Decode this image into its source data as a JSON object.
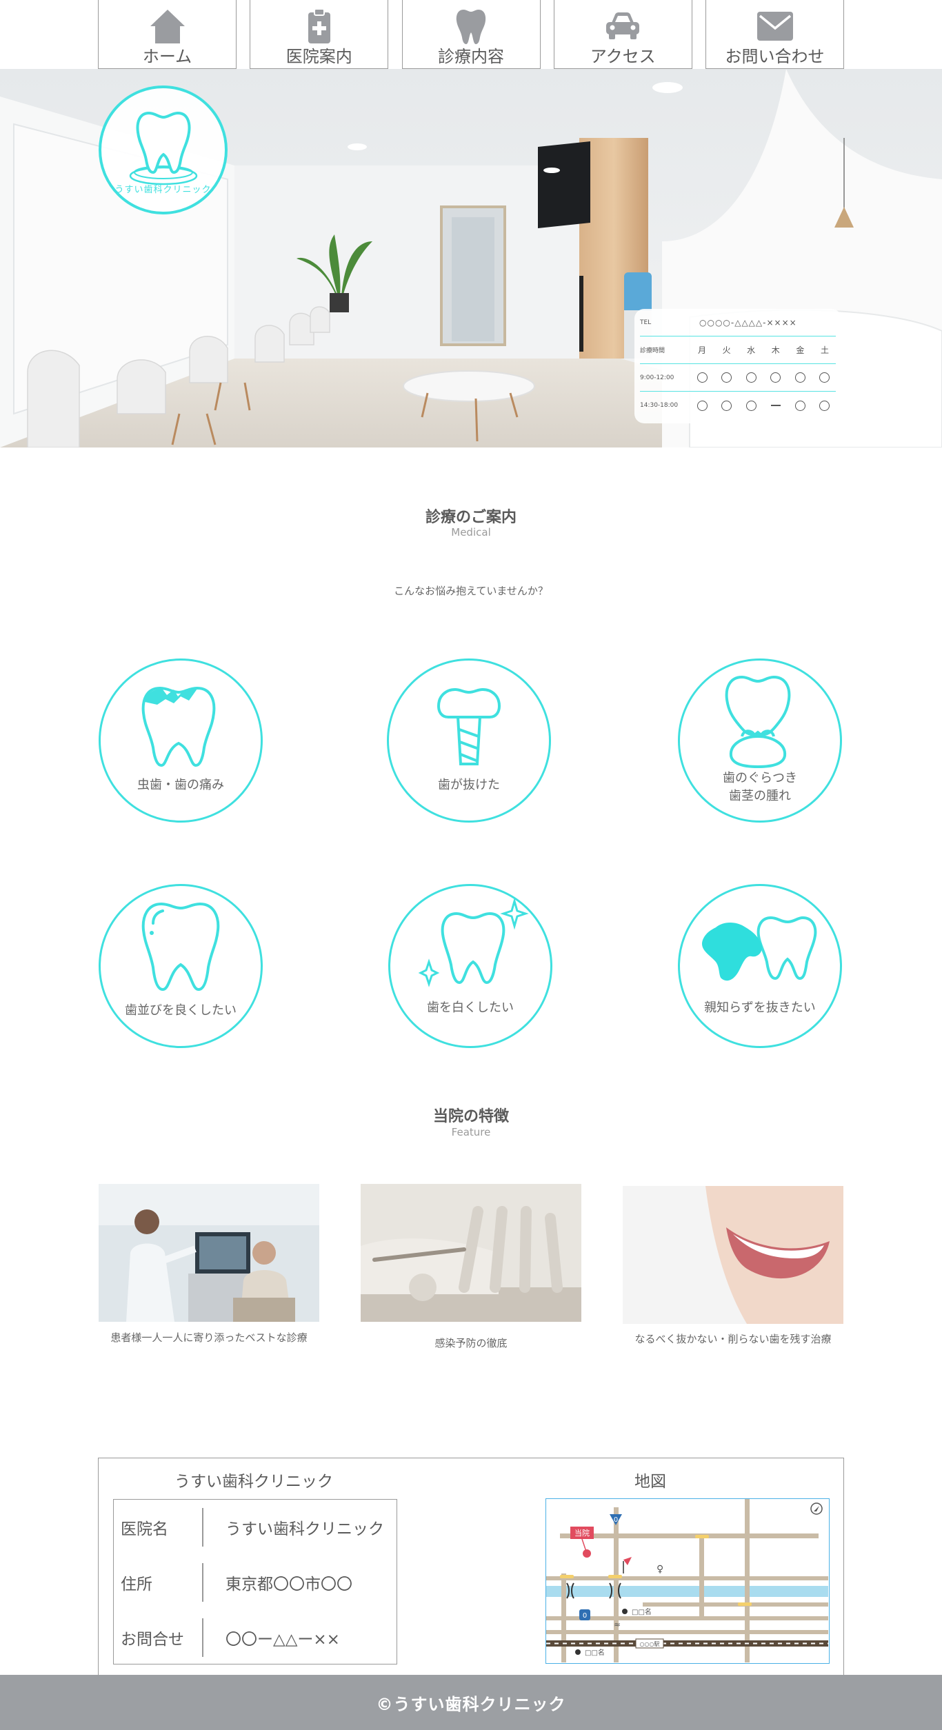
{
  "nav": [
    {
      "label": "ホーム",
      "icon": "home-icon"
    },
    {
      "label": "医院案内",
      "icon": "clipboard-medical-icon"
    },
    {
      "label": "診療内容",
      "icon": "tooth-icon"
    },
    {
      "label": "アクセス",
      "icon": "car-icon"
    },
    {
      "label": "お問い合わせ",
      "icon": "mail-icon"
    }
  ],
  "hero": {
    "logo_text": "うすい歯科クリニック",
    "hours": {
      "tel_label": "TEL",
      "tel_value": "○○○○-△△△△-××××",
      "header_label": "診療時間",
      "days": [
        "月",
        "火",
        "水",
        "木",
        "金",
        "土"
      ],
      "rows": [
        {
          "time": "9:00-12:00",
          "marks": [
            "○",
            "○",
            "○",
            "○",
            "○",
            "○"
          ]
        },
        {
          "time": "14:30-18:00",
          "marks": [
            "○",
            "○",
            "○",
            "ー",
            "○",
            "○"
          ]
        }
      ]
    }
  },
  "medical": {
    "title": "診療のご案内",
    "subtitle": "Medical",
    "lead": "こんなお悩み抱えていませんか？",
    "items": [
      {
        "label": "虫歯・歯の痛み",
        "icon": "cavity-tooth-icon"
      },
      {
        "label": "歯が抜けた",
        "icon": "implant-icon"
      },
      {
        "label_line1": "歯のぐらつき",
        "label_line2": "歯茎の腫れ",
        "icon": "gum-tooth-icon"
      },
      {
        "label": "歯並びを良くしたい",
        "icon": "straight-tooth-icon"
      },
      {
        "label": "歯を白くしたい",
        "icon": "sparkle-tooth-icon"
      },
      {
        "label": "親知らずを抜きたい",
        "icon": "wisdom-tooth-icon"
      }
    ]
  },
  "feature": {
    "title": "当院の特徴",
    "subtitle": "Feature",
    "items": [
      {
        "caption": "患者様一人一人に寄り添ったベストな診療"
      },
      {
        "caption": "感染予防の徹底"
      },
      {
        "caption": "なるべく抜かない・削らない歯を残す治療"
      }
    ]
  },
  "info": {
    "title": "うすい歯科クリニック",
    "rows": [
      {
        "key": "医院名",
        "value": "うすい歯科クリニック"
      },
      {
        "key": "住所",
        "value": "東京都〇〇市〇〇"
      },
      {
        "key": "お問合せ",
        "value": "〇〇ー△△ー××"
      }
    ],
    "map_title": "地図",
    "map": {
      "clinic_label": "当院",
      "route_number": "0",
      "poi_1": "□□名",
      "poi_2": "□□名",
      "station": "○○○駅"
    }
  },
  "footer": {
    "copyright": "©うすい歯科クリニック"
  },
  "colors": {
    "accent": "#3fe0df",
    "footer": "#9c9fa3",
    "text": "#5a5a5a"
  }
}
